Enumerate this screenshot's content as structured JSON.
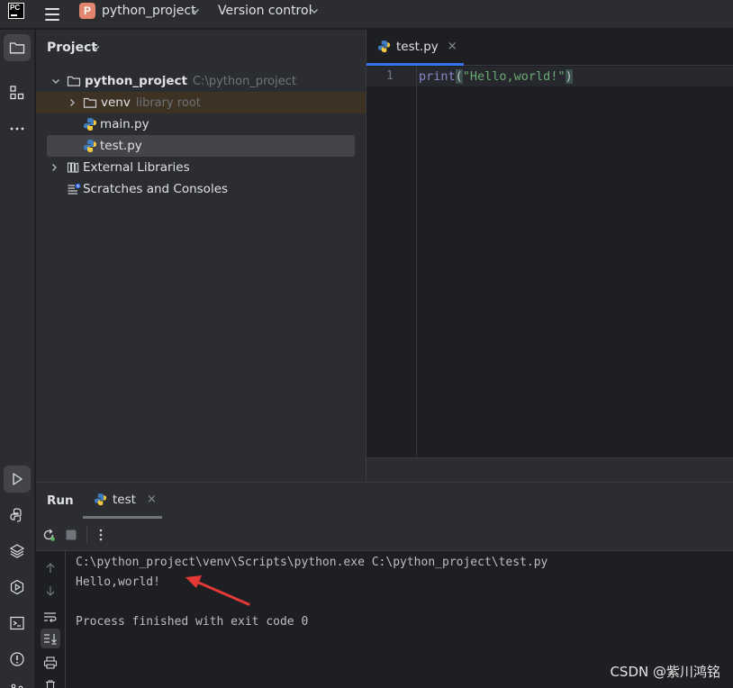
{
  "titlebar": {
    "logo_text": "PC",
    "project_badge": "P",
    "project_name": "python_project",
    "vcs_label": "Version control"
  },
  "project_panel": {
    "title": "Project",
    "tree": [
      {
        "label": "python_project",
        "hint": "C:\\python_project",
        "icon": "folder-icon",
        "expanded": true
      },
      {
        "label": "venv",
        "hint": "library root",
        "icon": "folder-icon",
        "expanded": false
      },
      {
        "label": "main.py",
        "icon": "python-file-icon"
      },
      {
        "label": "test.py",
        "icon": "python-file-icon",
        "selected": true
      },
      {
        "label": "External Libraries",
        "icon": "library-icon",
        "expanded": false
      },
      {
        "label": "Scratches and Consoles",
        "icon": "scratches-icon"
      }
    ]
  },
  "editor": {
    "tab_label": "test.py",
    "tab_close": "×",
    "line_number": "1",
    "code": {
      "fn": "print",
      "open": "(",
      "str": "\"Hello,world!\"",
      "close": ")"
    }
  },
  "run_panel": {
    "title": "Run",
    "tab_label": "test",
    "tab_close": "×",
    "console_lines": [
      "C:\\python_project\\venv\\Scripts\\python.exe C:\\python_project\\test.py",
      "Hello,world!",
      "",
      "Process finished with exit code 0"
    ]
  },
  "watermark": "CSDN @紫川鸿铭",
  "colors": {
    "accent": "#3574f0",
    "annotation_arrow": "#e53935",
    "string": "#6aab73",
    "builtin": "#8888c6"
  }
}
